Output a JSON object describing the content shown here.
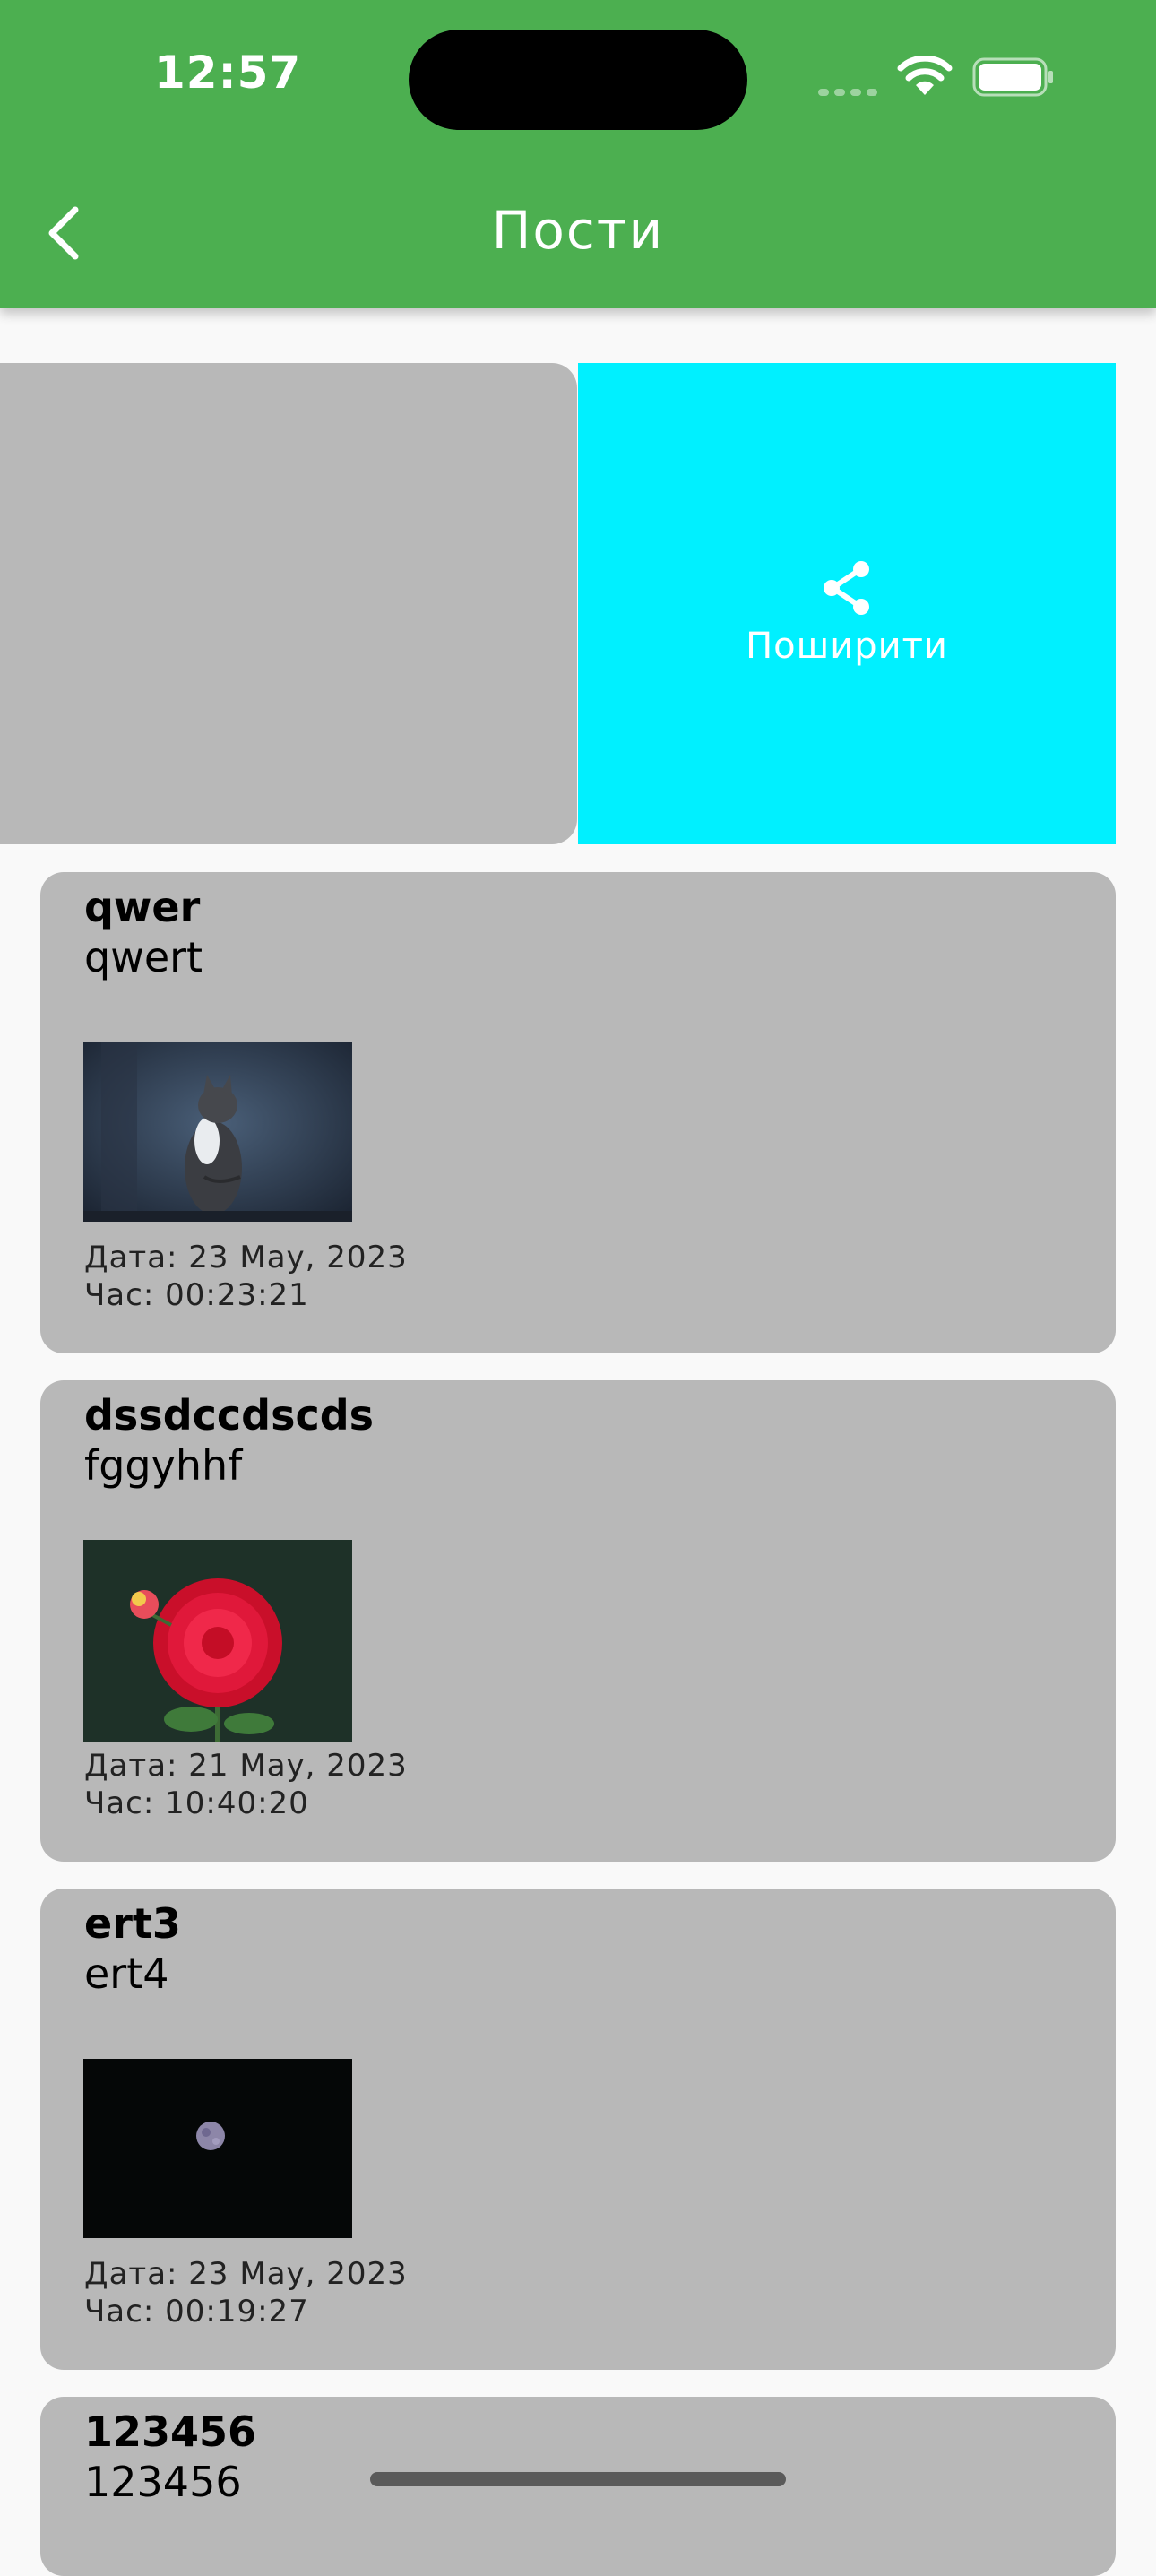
{
  "status_bar": {
    "time": "12:57"
  },
  "header": {
    "title": "Пости"
  },
  "swipe_action": {
    "share_label": "Поширити"
  },
  "posts": [
    {
      "title": "qwer",
      "text": "qwert",
      "date": "Дата: 23 May, 2023",
      "time": "Час: 00:23:21",
      "image": "cat-photo"
    },
    {
      "title": "dssdccdscds",
      "text": "fggyhhf",
      "date": "Дата: 21 May, 2023",
      "time": "Час: 10:40:20",
      "image": "flower-photo"
    },
    {
      "title": "ert3",
      "text": "ert4",
      "date": "Дата: 23 May, 2023",
      "time": "Час: 00:19:27",
      "image": "moon-photo"
    },
    {
      "title": "123456",
      "text": "123456"
    }
  ],
  "colors": {
    "header": "#4caf50",
    "share_action": "#00f0ff",
    "card": "#b8b8b8",
    "background": "#f9f9f9"
  }
}
